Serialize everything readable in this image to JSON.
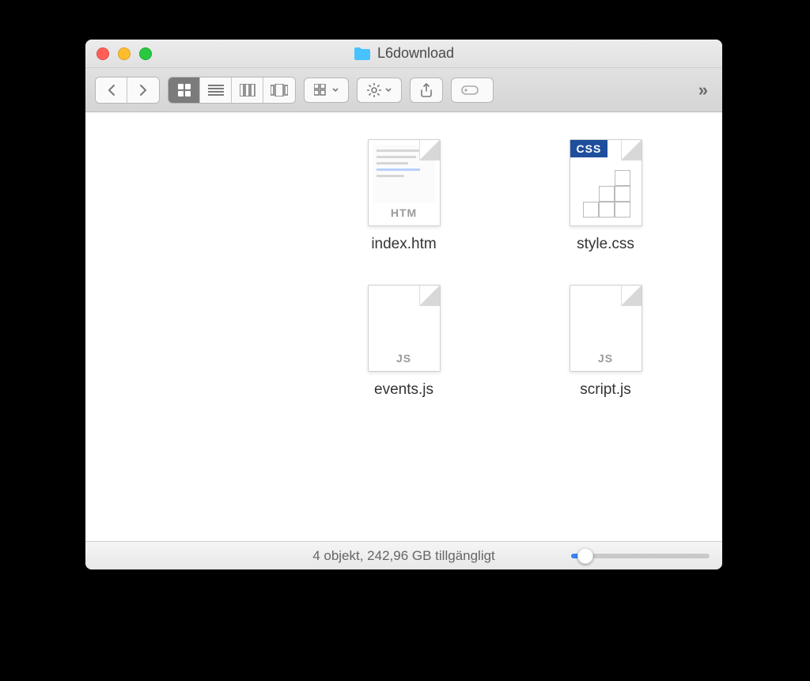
{
  "window": {
    "title": "L6download",
    "folder_icon": "folder-icon"
  },
  "toolbar": {
    "back": "back",
    "forward": "forward",
    "view_icons": "icon-view",
    "view_list": "list-view",
    "view_columns": "column-view",
    "view_cover": "cover-flow-view",
    "group": "group",
    "action": "action",
    "share": "share",
    "tags": "tags",
    "overflow": "more"
  },
  "files": [
    {
      "name": "index.htm",
      "kind": "htm",
      "badge": "HTM"
    },
    {
      "name": "style.css",
      "kind": "css",
      "badge": "CSS"
    },
    {
      "name": "events.js",
      "kind": "js",
      "badge": "JS"
    },
    {
      "name": "script.js",
      "kind": "js",
      "badge": "JS"
    }
  ],
  "status": {
    "text": "4 objekt, 242,96 GB tillgängligt"
  }
}
